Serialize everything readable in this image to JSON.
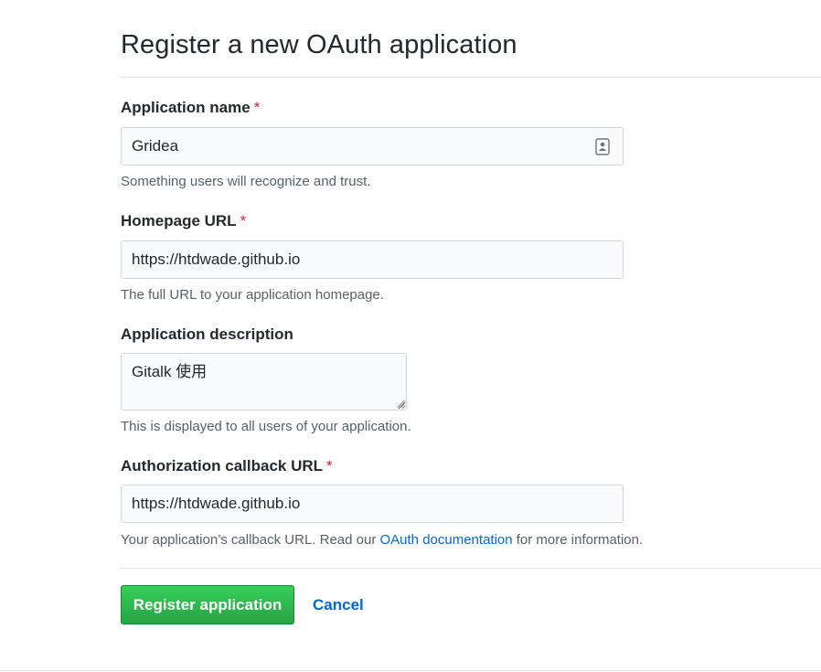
{
  "page": {
    "title": "Register a new OAuth application"
  },
  "form": {
    "required_marker": "*",
    "app_name": {
      "label": "Application name",
      "value": "Gridea",
      "hint": "Something users will recognize and trust.",
      "icon": "contact-card-icon"
    },
    "homepage_url": {
      "label": "Homepage URL",
      "value": "https://htdwade.github.io",
      "hint": "The full URL to your application homepage."
    },
    "description": {
      "label": "Application description",
      "value": "Gitalk 使用",
      "hint": "This is displayed to all users of your application."
    },
    "callback_url": {
      "label": "Authorization callback URL",
      "value": "https://htdwade.github.io",
      "hint_before": "Your application’s callback URL. Read our ",
      "hint_link": "OAuth documentation",
      "hint_after": " for more information."
    }
  },
  "actions": {
    "submit_label": "Register application",
    "cancel_label": "Cancel"
  },
  "colors": {
    "primary_button": "#28a745",
    "link": "#0366d6",
    "required": "#cb2431"
  }
}
